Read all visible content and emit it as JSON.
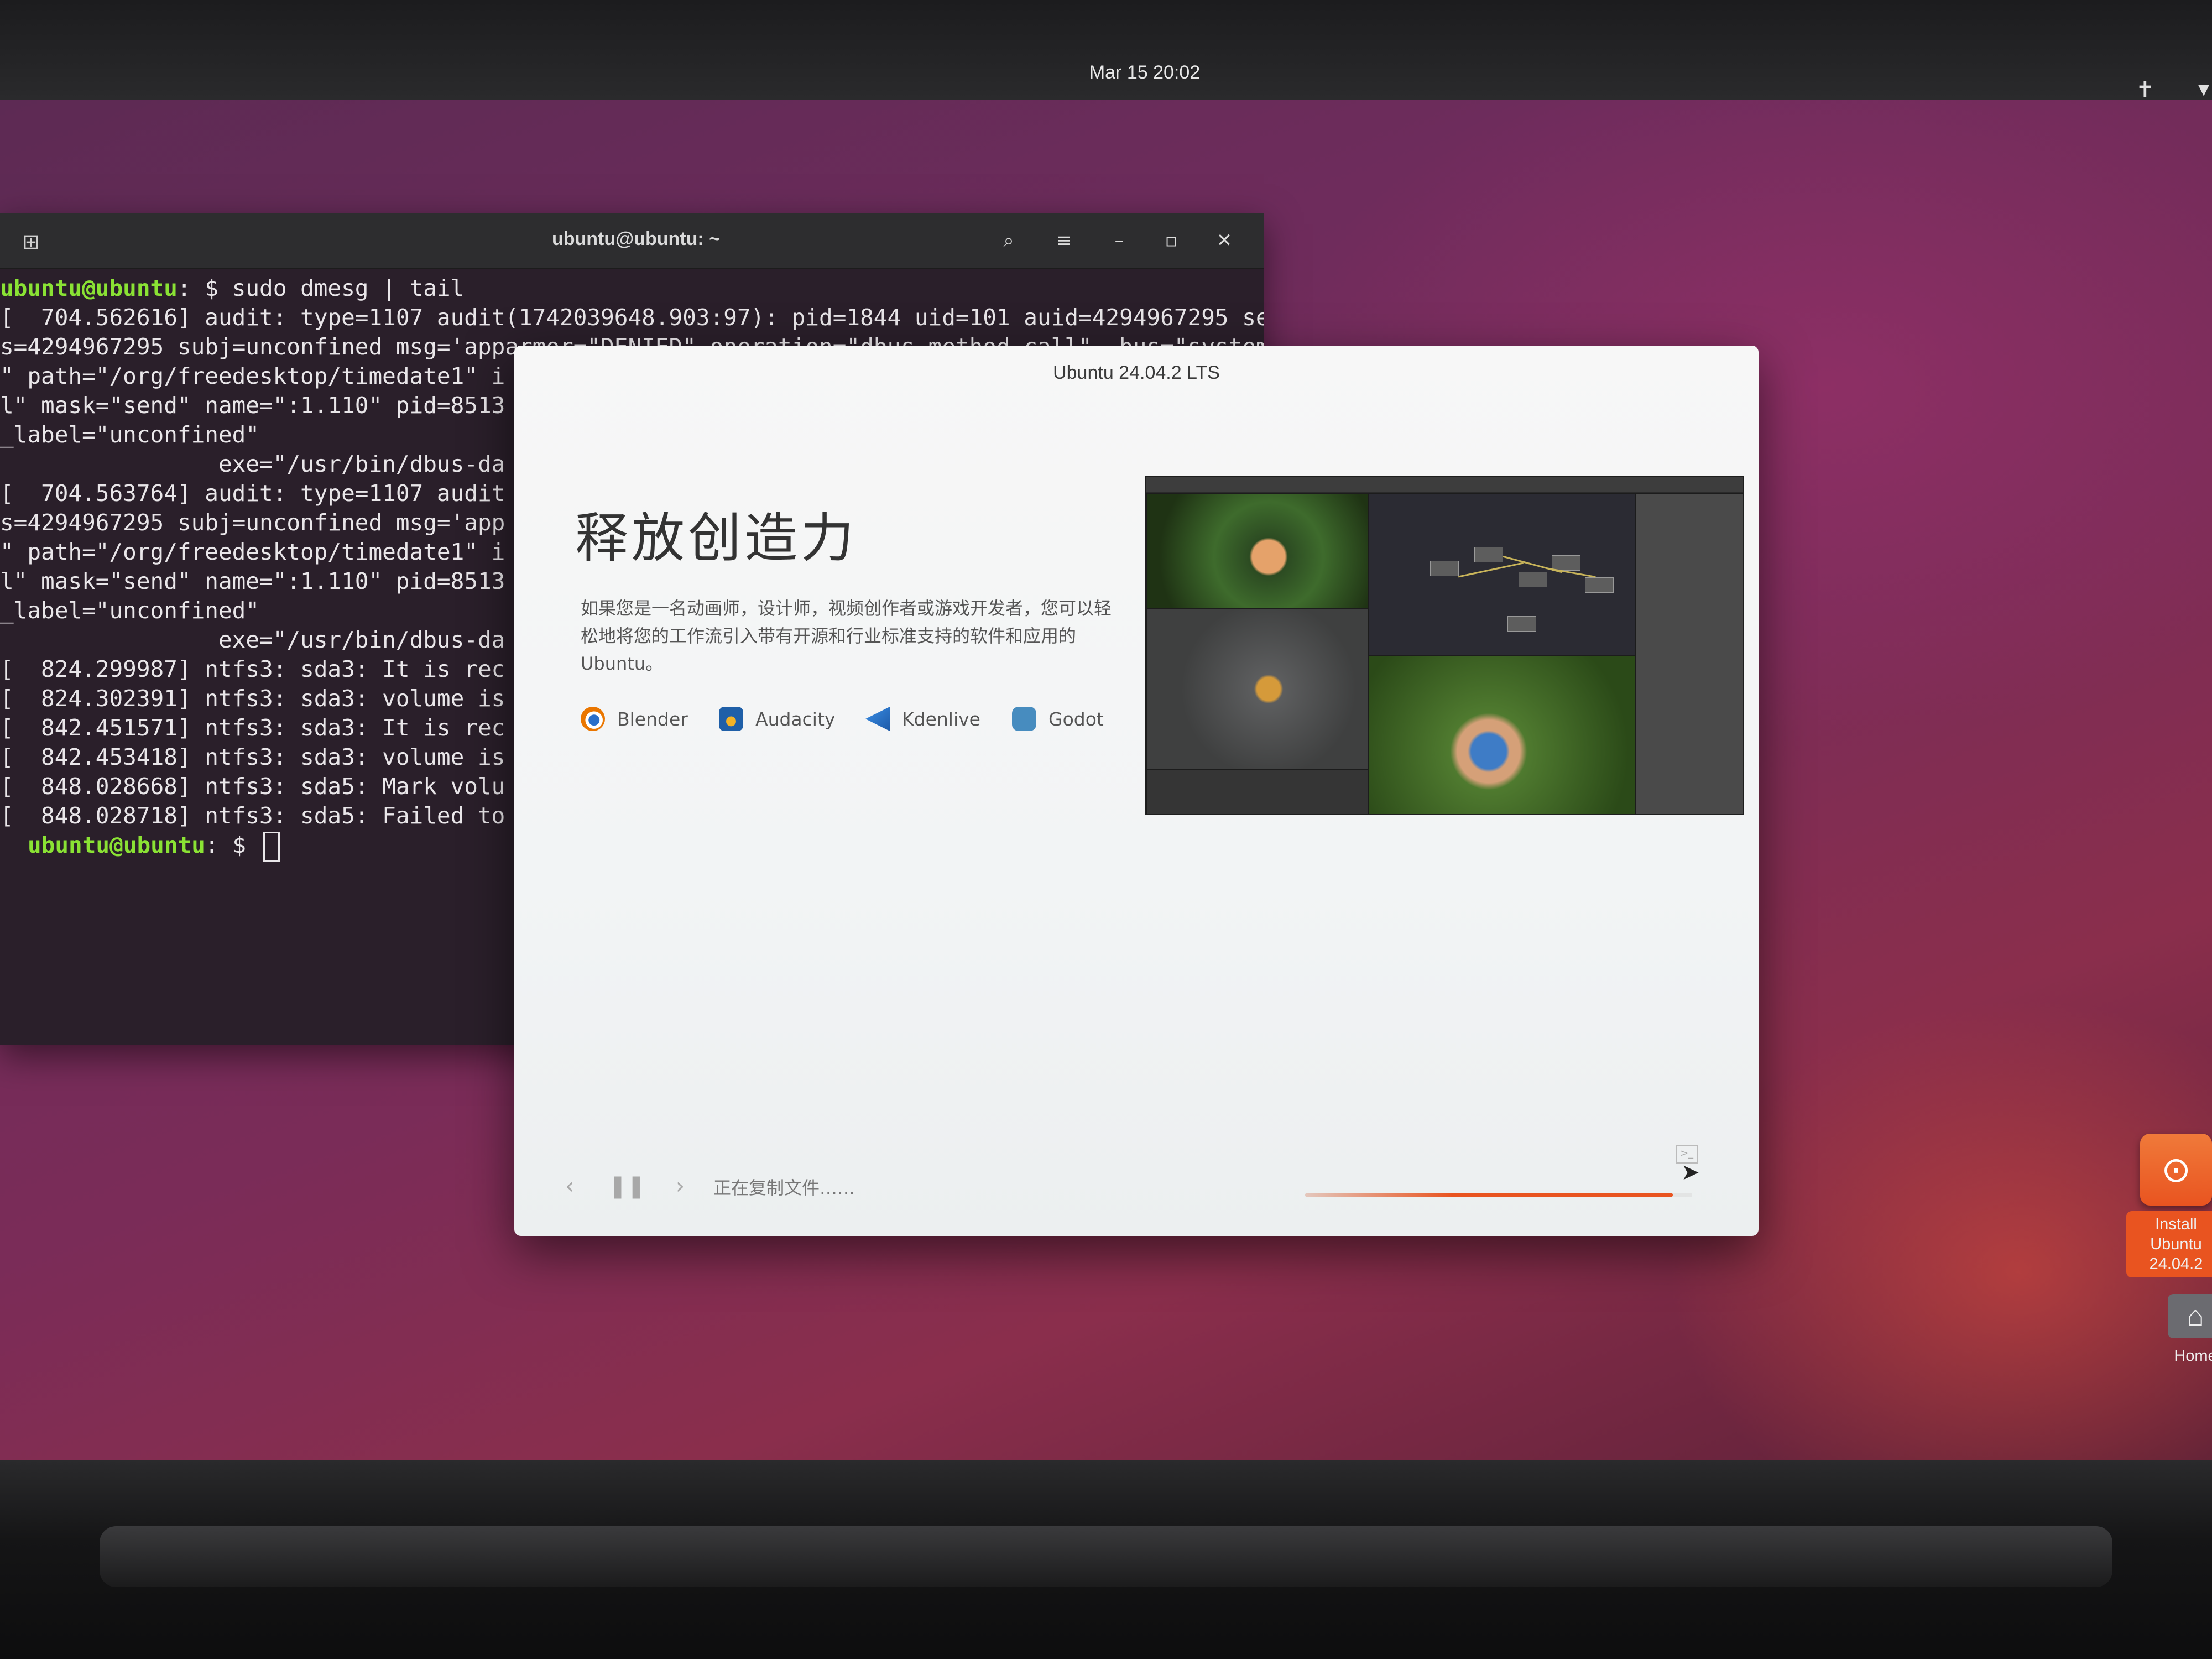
{
  "topbar": {
    "clock": "Mar 15  20:02",
    "accessibility_icon": "accessibility-icon",
    "system_icon": "system-menu-icon"
  },
  "terminal": {
    "title": "ubuntu@ubuntu: ~",
    "lines": [
      {
        "prompt": "ubuntu@ubuntu",
        "text": ": $ sudo dmesg | tail"
      },
      {
        "text": "[  704.562616] audit: type=1107 audit(1742039648.903:97): pid=1844 uid=101 auid=4294967295 se"
      },
      {
        "text": "s=4294967295 subj=unconfined msg='apparmor=\"DENIED\" operation=\"dbus_method_call\"  bus=\"system"
      },
      {
        "text": "\" path=\"/org/freedesktop/timedate1\" i"
      },
      {
        "text": "l\" mask=\"send\" name=\":1.110\" pid=8513"
      },
      {
        "text": "_label=\"unconfined\""
      },
      {
        "text": "                exe=\"/usr/bin/dbus-da"
      },
      {
        "text": "[  704.563764] audit: type=1107 audit"
      },
      {
        "text": "s=4294967295 subj=unconfined msg='app"
      },
      {
        "text": "\" path=\"/org/freedesktop/timedate1\" i"
      },
      {
        "text": "l\" mask=\"send\" name=\":1.110\" pid=8513"
      },
      {
        "text": "_label=\"unconfined\""
      },
      {
        "text": "                exe=\"/usr/bin/dbus-da"
      },
      {
        "text": "[  824.299987] ntfs3: sda3: It is rec"
      },
      {
        "text": "[  824.302391] ntfs3: sda3: volume is"
      },
      {
        "text": "[  842.451571] ntfs3: sda3: It is rec"
      },
      {
        "text": "[  842.453418] ntfs3: sda3: volume is"
      },
      {
        "text": "[  848.028668] ntfs3: sda5: Mark volu"
      },
      {
        "text": "[  848.028718] ntfs3: sda5: Failed to"
      }
    ],
    "final_prompt": "ubuntu@ubuntu",
    "final_prompt_suffix": ": $ "
  },
  "installer": {
    "title": "Ubuntu 24.04.2 LTS",
    "heading": "释放创造力",
    "description": "如果您是一名动画师，设计师，视频创作者或游戏开发者，您可以轻松地将您的工作流引入带有开源和行业标准支持的软件和应用的 Ubuntu。",
    "apps": [
      {
        "label": "Blender",
        "icon": "blender-icon"
      },
      {
        "label": "Audacity",
        "icon": "audacity-icon"
      },
      {
        "label": "Kdenlive",
        "icon": "kdenlive-icon"
      },
      {
        "label": "Godot",
        "icon": "godot-icon"
      }
    ],
    "status": "正在复制文件……",
    "progress": 0.95
  },
  "desktop": {
    "install_icon_label_1": "Install Ubuntu",
    "install_icon_label_2": "24.04.2",
    "home_label": "Home"
  },
  "colors": {
    "accent": "#e95420",
    "prompt": "#8ae234"
  }
}
